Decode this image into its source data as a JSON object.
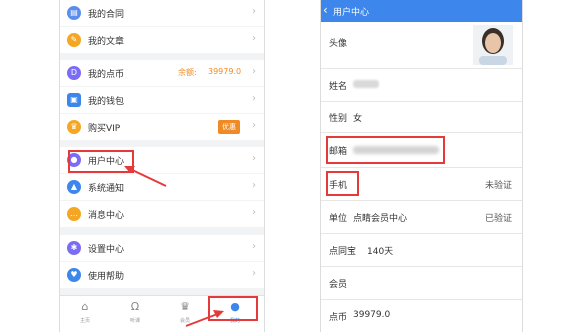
{
  "left": {
    "menu": [
      {
        "label": "我的合同",
        "icon": "contract-icon",
        "color": "#5b8def"
      },
      {
        "label": "我的文章",
        "icon": "pencil-icon",
        "color": "#f5a623"
      },
      {
        "label": "我的点币",
        "icon": "coin-icon",
        "color": "#7b6cf6",
        "extra_label": "余额:",
        "extra_value": "39979.0"
      },
      {
        "label": "我的钱包",
        "icon": "wallet-icon",
        "color": "#3c86ec"
      },
      {
        "label": "购买VIP",
        "icon": "crown-icon",
        "color": "#f5a623",
        "badge": "优惠"
      },
      {
        "label": "用户中心",
        "icon": "user-icon",
        "color": "#7b6cf6"
      },
      {
        "label": "系统通知",
        "icon": "bell-icon",
        "color": "#3c86ec"
      },
      {
        "label": "消息中心",
        "icon": "message-icon",
        "color": "#f5a623"
      },
      {
        "label": "设置中心",
        "icon": "gear-icon",
        "color": "#7b6cf6"
      },
      {
        "label": "使用帮助",
        "icon": "heart-icon",
        "color": "#3c86ec"
      }
    ],
    "tabs": [
      {
        "label": "主页",
        "icon": "home-icon"
      },
      {
        "label": "听课",
        "icon": "headphones-icon"
      },
      {
        "label": "会员",
        "icon": "crown-icon"
      },
      {
        "label": "我的",
        "icon": "profile-icon"
      }
    ]
  },
  "right": {
    "header_title": "用户中心",
    "fields": {
      "avatar_label": "头像",
      "name_label": "姓名",
      "gender_label": "性别",
      "gender_value": "女",
      "email_label": "邮箱",
      "phone_label": "手机",
      "phone_status": "未验证",
      "unit_label": "单位",
      "unit_value": "点睛会员中心",
      "unit_status": "已验证",
      "treasure_label": "点同宝",
      "treasure_value": "140天",
      "member_label": "会员",
      "coin_label": "点币",
      "coin_value": "39979.0"
    }
  },
  "colors": {
    "accent": "#3c86ec",
    "highlight": "#e53a3a",
    "badge": "#f08a24"
  }
}
